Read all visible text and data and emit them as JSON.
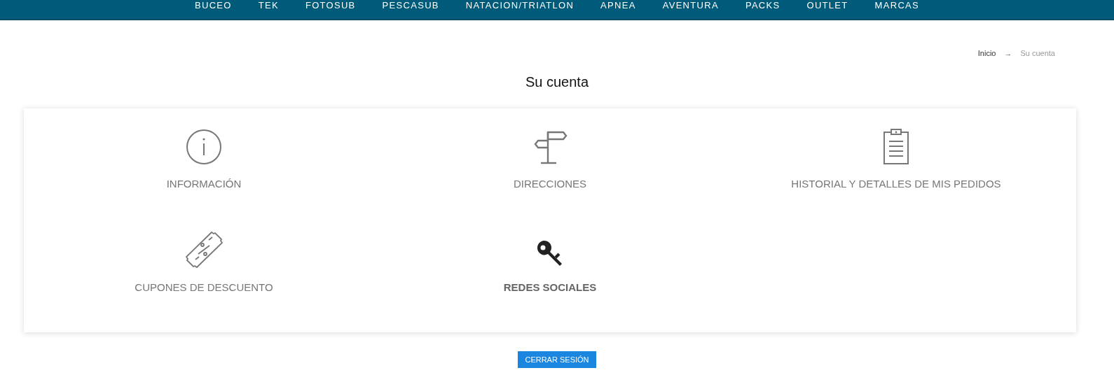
{
  "nav": [
    "BUCEO",
    "TEK",
    "FOTOSUB",
    "PESCASUB",
    "NATACION/TRIATLON",
    "APNEA",
    "AVENTURA",
    "PACKS",
    "OUTLET",
    "MARCAS"
  ],
  "breadcrumb": {
    "home": "Inicio",
    "separator": "→",
    "current": "Su cuenta"
  },
  "title": "Su cuenta",
  "links": [
    {
      "kind": "info",
      "label": "INFORMACIÓN",
      "bold": false
    },
    {
      "kind": "signpost",
      "label": "DIRECCIONES",
      "bold": false
    },
    {
      "kind": "clipboard",
      "label": "HISTORIAL Y DETALLES DE MIS PEDIDOS",
      "bold": false
    },
    {
      "kind": "coupon",
      "label": "CUPONES DE DESCUENTO",
      "bold": false
    },
    {
      "kind": "key",
      "label": "REDES SOCIALES",
      "bold": true
    }
  ],
  "logout": "CERRAR SESIÓN"
}
